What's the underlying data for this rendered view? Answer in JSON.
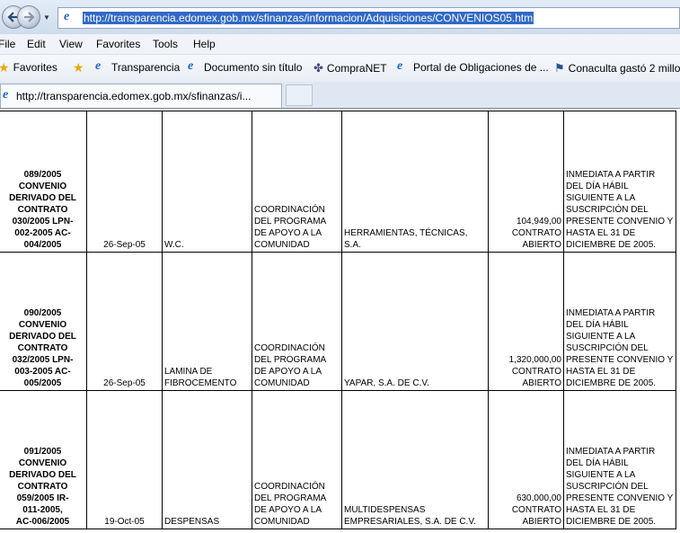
{
  "browser": {
    "address_url": "http://transparencia.edomex.gob.mx/sfinanzas/informacion/Adquisiciones/CONVENIOS05.htm",
    "menu": [
      "File",
      "Edit",
      "View",
      "Favorites",
      "Tools",
      "Help"
    ],
    "favorites_label": "Favorites",
    "favorites_links": [
      "Transparencia",
      "Documento sin título",
      "CompraNET",
      "Portal de Obligaciones de ...",
      "Conaculta gastó 2 millo"
    ],
    "tab_title": "http://transparencia.edomex.gob.mx/sfinanzas/i...",
    "accent_color": "#3169c6"
  },
  "table": {
    "rows": [
      {
        "id": "089/2005\nCONVENIO\nDERIVADO DEL\nCONTRATO\n030/2005    LPN-\n002-2005    AC-\n004/2005",
        "date": "26-Sep-05",
        "concept": "W.C.",
        "area": "COORDINACIÓN DEL PROGRAMA DE APOYO A LA COMUNIDAD",
        "supplier": "HERRAMIENTAS, TÉCNICAS, S.A.",
        "amount": "104,949,00 CONTRATO ABIERTO",
        "term": "INMEDIATA A PARTIR DEL DÍA HÁBIL SIGUIENTE A LA SUSCRIPCIÓN DEL PRESENTE CONVENIO Y HASTA EL 31 DE DICIEMBRE DE 2005."
      },
      {
        "id": "090/2005\nCONVENIO\nDERIVADO DEL\nCONTRATO\n032/2005    LPN-\n003-2005    AC-\n005/2005",
        "date": "26-Sep-05",
        "concept": "LAMINA DE FIBROCEMENTO",
        "area": "COORDINACIÓN DEL PROGRAMA DE APOYO A LA COMUNIDAD",
        "supplier": "YAPAR, S.A. DE C.V.",
        "amount": "1,320,000,00 CONTRATO ABIERTO",
        "term": "INMEDIATA A PARTIR DEL DÍA HÁBIL SIGUIENTE A LA SUSCRIPCIÓN DEL PRESENTE CONVENIO Y HASTA EL 31 DE DICIEMBRE DE 2005."
      },
      {
        "id": "091/2005\nCONVENIO\nDERIVADO DEL\nCONTRATO\n059/2005     IR-\n011-2005,\nAC-006/2005",
        "date": "19-Oct-05",
        "concept": "DESPENSAS",
        "area": "COORDINACIÓN DEL PROGRAMA DE APOYO A LA COMUNIDAD",
        "supplier": "MULTIDESPENSAS EMPRESARIALES, S.A. DE C.V.",
        "amount": "630,000,00 CONTRATO ABIERTO",
        "term": "INMEDIATA A PARTIR DEL DÍA HÁBIL SIGUIENTE A LA SUSCRIPCIÓN DEL PRESENTE CONVENIO Y HASTA EL 31 DE DICIEMBRE DE 2005."
      }
    ]
  }
}
